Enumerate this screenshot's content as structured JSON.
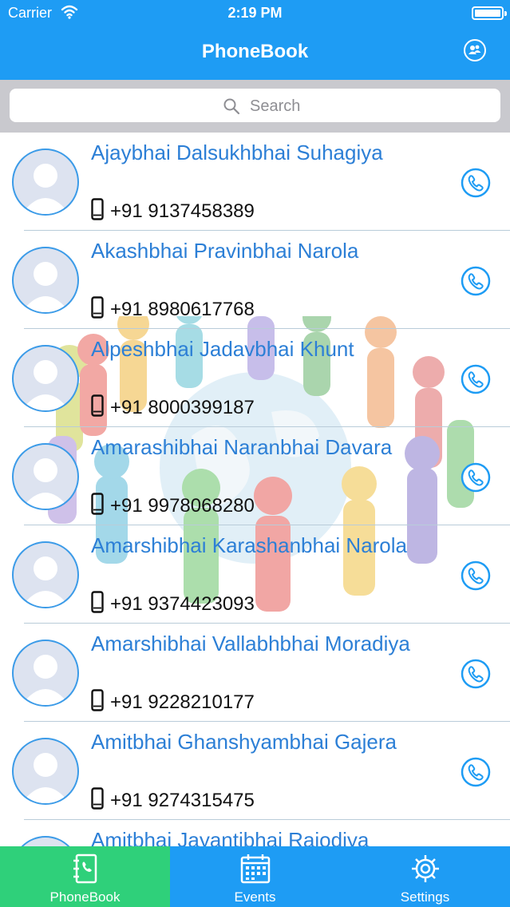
{
  "status_bar": {
    "carrier": "Carrier",
    "time": "2:19 PM"
  },
  "nav": {
    "title": "PhoneBook",
    "right_icon": "group-icon"
  },
  "search": {
    "placeholder": "Search"
  },
  "contacts": [
    {
      "name": "Ajaybhai Dalsukhbhai Suhagiya",
      "phone": "+91 9137458389"
    },
    {
      "name": "Akashbhai Pravinbhai Narola",
      "phone": "+91 8980617768"
    },
    {
      "name": "Alpeshbhai Jadavbhai Khunt",
      "phone": "+91 8000399187"
    },
    {
      "name": "Amarashibhai Naranbhai Davara",
      "phone": "+91 9978068280"
    },
    {
      "name": "Amarshibhai Karashanbhai Narola",
      "phone": "+91 9374423093"
    },
    {
      "name": "Amarshibhai Vallabhbhai Moradiya",
      "phone": "+91 9228210177"
    },
    {
      "name": "Amitbhai Ghanshyambhai Gajera",
      "phone": "+91 9274315475"
    },
    {
      "name": "Amitbhai Jayantibhai Rajodiya",
      "phone": ""
    }
  ],
  "tabbar": {
    "tabs": [
      {
        "label": "PhoneBook",
        "icon": "phonebook-icon",
        "active": true
      },
      {
        "label": "Events",
        "icon": "calendar-icon",
        "active": false
      },
      {
        "label": "Settings",
        "icon": "gear-icon",
        "active": false
      }
    ]
  },
  "colors": {
    "primary": "#1e9cf4",
    "active_tab": "#2fd07a",
    "name_text": "#2c7fd6"
  }
}
